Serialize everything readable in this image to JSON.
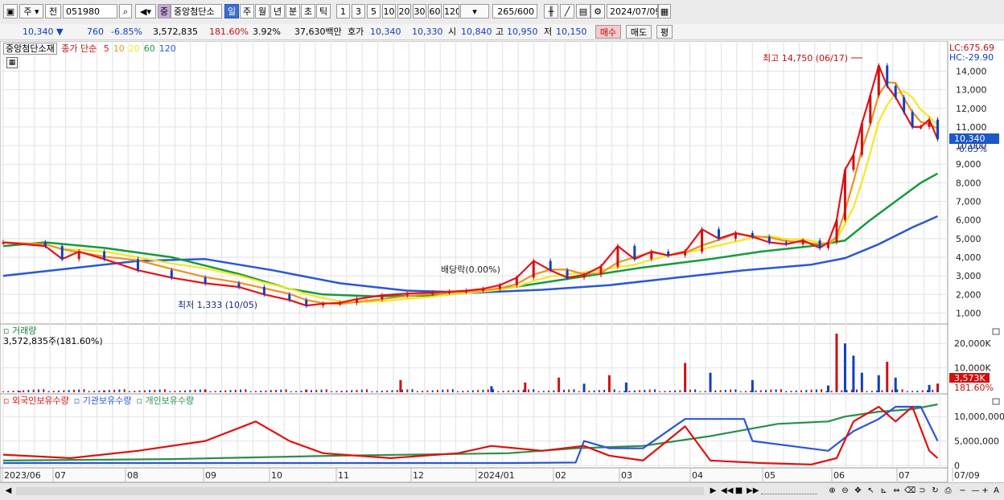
{
  "toolbar": {
    "market": "주",
    "prefix": "전",
    "code": "051980",
    "search_icon": "magnifier-icon",
    "stock_badge": "중",
    "stock_name": "중앙첨단소",
    "periods": [
      "일",
      "주",
      "월",
      "년",
      "분",
      "초",
      "틱"
    ],
    "active_period": "일",
    "intervals": [
      "1",
      "3",
      "5",
      "10",
      "20",
      "30",
      "60",
      "120"
    ],
    "count": "265",
    "count_total": "/600",
    "date": "2024/07/09"
  },
  "quote": {
    "price": "10,340",
    "change": "760",
    "change_pct": "-6.85%",
    "volume": "3,572,835",
    "vol_ratio": "181.60%",
    "turnover": "3.92%",
    "amount": "37,630백만",
    "ask_label": "호가",
    "ask": "10,340",
    "bid": "10,330",
    "open_label": "시",
    "open": "10,840",
    "high_label": "고",
    "high": "10,950",
    "low_label": "저",
    "low": "10,150",
    "buy": "매수",
    "sell": "매도",
    "eval": "평"
  },
  "legend": {
    "name": "중앙첨단소재",
    "type": "종가 단순",
    "ma": [
      {
        "label": "5",
        "color": "#e8101a"
      },
      {
        "label": "10",
        "color": "#f09020"
      },
      {
        "label": "20",
        "color": "#f5e81e"
      },
      {
        "label": "60",
        "color": "#169a3c"
      },
      {
        "label": "120",
        "color": "#2a57d6"
      }
    ]
  },
  "annotations": {
    "high": "최고 14,750 (06/17)",
    "low": "최저 1,333 (10/05)",
    "dividend": "배당락(0.00%)",
    "lc": "LC:675.69",
    "hc": "HC:-29.90",
    "last": "10,340",
    "last_pct": "-6.85%"
  },
  "volume_panel": {
    "title": "거래량",
    "value": "3,572,835주(181.60%)",
    "axis": [
      "20,000K",
      "10,000K"
    ],
    "last": "3,573K",
    "last_pct": "181.60%"
  },
  "holding_panel": {
    "series": [
      {
        "name": "외국인보유수량",
        "color": "#e01010"
      },
      {
        "name": "기관보유수량",
        "color": "#2a57d6"
      },
      {
        "name": "개인보유수량",
        "color": "#2a8f4a"
      }
    ],
    "axis": [
      "10,000,000",
      "5,000,000",
      "0"
    ]
  },
  "chart_data": {
    "type": "line",
    "price_axis": [
      "14,000",
      "13,000",
      "12,000",
      "11,000",
      "10,000",
      "9,000",
      "8,000",
      "7,000",
      "6,000",
      "5,000",
      "4,000",
      "3,000",
      "2,000",
      "1,000"
    ],
    "price_range": [
      500,
      15100
    ],
    "x_labels": [
      "2023/06",
      "07",
      "08",
      "09",
      "10",
      "11",
      "12",
      "2024/01",
      "02",
      "03",
      "04",
      "05",
      "06",
      "07",
      "07/09"
    ],
    "close": [
      [
        0,
        4800
      ],
      [
        25,
        4600
      ],
      [
        35,
        3900
      ],
      [
        45,
        4300
      ],
      [
        60,
        3900
      ],
      [
        80,
        3300
      ],
      [
        100,
        2900
      ],
      [
        120,
        2600
      ],
      [
        140,
        2400
      ],
      [
        155,
        2000
      ],
      [
        170,
        1700
      ],
      [
        180,
        1400
      ],
      [
        190,
        1500
      ],
      [
        200,
        1550
      ],
      [
        210,
        1750
      ],
      [
        225,
        1950
      ],
      [
        240,
        2050
      ],
      [
        255,
        2100
      ],
      [
        265,
        2150
      ],
      [
        275,
        2200
      ],
      [
        285,
        2300
      ],
      [
        295,
        2500
      ],
      [
        305,
        2900
      ],
      [
        315,
        3800
      ],
      [
        325,
        3300
      ],
      [
        335,
        2900
      ],
      [
        345,
        3050
      ],
      [
        355,
        3500
      ],
      [
        365,
        4600
      ],
      [
        375,
        3900
      ],
      [
        385,
        4300
      ],
      [
        395,
        4100
      ],
      [
        405,
        4300
      ],
      [
        415,
        5500
      ],
      [
        425,
        5000
      ],
      [
        435,
        5300
      ],
      [
        445,
        5100
      ],
      [
        455,
        4800
      ],
      [
        465,
        4700
      ],
      [
        475,
        4900
      ],
      [
        485,
        4500
      ],
      [
        490,
        4800
      ],
      [
        495,
        6000
      ],
      [
        500,
        8700
      ],
      [
        505,
        9500
      ],
      [
        510,
        11200
      ],
      [
        515,
        12700
      ],
      [
        520,
        14300
      ],
      [
        525,
        13200
      ],
      [
        530,
        12600
      ],
      [
        535,
        11800
      ],
      [
        540,
        11000
      ],
      [
        545,
        11000
      ],
      [
        550,
        11400
      ],
      [
        555,
        10340
      ]
    ],
    "ma60": [
      [
        0,
        4600
      ],
      [
        25,
        4800
      ],
      [
        60,
        4500
      ],
      [
        100,
        4000
      ],
      [
        140,
        3100
      ],
      [
        170,
        2300
      ],
      [
        190,
        2000
      ],
      [
        220,
        1900
      ],
      [
        260,
        1950
      ],
      [
        300,
        2350
      ],
      [
        340,
        2900
      ],
      [
        380,
        3450
      ],
      [
        420,
        3900
      ],
      [
        450,
        4300
      ],
      [
        480,
        4600
      ],
      [
        500,
        4900
      ],
      [
        515,
        6000
      ],
      [
        530,
        7000
      ],
      [
        545,
        8000
      ],
      [
        555,
        8500
      ]
    ],
    "ma120": [
      [
        0,
        3000
      ],
      [
        40,
        3400
      ],
      [
        80,
        3800
      ],
      [
        120,
        3900
      ],
      [
        160,
        3300
      ],
      [
        200,
        2600
      ],
      [
        240,
        2200
      ],
      [
        280,
        2100
      ],
      [
        320,
        2250
      ],
      [
        360,
        2500
      ],
      [
        400,
        2900
      ],
      [
        440,
        3300
      ],
      [
        480,
        3600
      ],
      [
        500,
        3950
      ],
      [
        520,
        4700
      ],
      [
        540,
        5600
      ],
      [
        555,
        6200
      ]
    ],
    "volume_series": [
      [
        10,
        500
      ],
      [
        60,
        700
      ],
      [
        120,
        900
      ],
      [
        180,
        1100
      ],
      [
        236,
        5000
      ],
      [
        290,
        2500
      ],
      [
        310,
        4000
      ],
      [
        330,
        6000
      ],
      [
        345,
        3500
      ],
      [
        360,
        7000
      ],
      [
        370,
        4000
      ],
      [
        405,
        12000
      ],
      [
        420,
        8000
      ],
      [
        445,
        5000
      ],
      [
        490,
        2800
      ],
      [
        495,
        24000
      ],
      [
        500,
        20000
      ],
      [
        505,
        15000
      ],
      [
        510,
        8000
      ],
      [
        520,
        7000
      ],
      [
        525,
        12500
      ],
      [
        530,
        6000
      ],
      [
        550,
        3000
      ],
      [
        555,
        3573
      ]
    ],
    "foreign_holding": [
      [
        0,
        2200000
      ],
      [
        40,
        1500000
      ],
      [
        80,
        3000000
      ],
      [
        120,
        5000000
      ],
      [
        150,
        9000000
      ],
      [
        170,
        5000000
      ],
      [
        190,
        2500000
      ],
      [
        230,
        1500000
      ],
      [
        270,
        2500000
      ],
      [
        290,
        4000000
      ],
      [
        320,
        3000000
      ],
      [
        345,
        4000000
      ],
      [
        360,
        2000000
      ],
      [
        380,
        1000000
      ],
      [
        405,
        8000000
      ],
      [
        420,
        1000000
      ],
      [
        450,
        500000
      ],
      [
        480,
        200000
      ],
      [
        495,
        1500000
      ],
      [
        505,
        9000000
      ],
      [
        520,
        12000000
      ],
      [
        530,
        9000000
      ],
      [
        540,
        12000000
      ],
      [
        550,
        3000000
      ],
      [
        555,
        1500000
      ]
    ],
    "institution_holding": [
      [
        0,
        500000
      ],
      [
        100,
        500000
      ],
      [
        200,
        500000
      ],
      [
        300,
        500000
      ],
      [
        340,
        600000
      ],
      [
        345,
        5000000
      ],
      [
        360,
        3500000
      ],
      [
        380,
        3500000
      ],
      [
        405,
        9500000
      ],
      [
        440,
        9500000
      ],
      [
        445,
        5000000
      ],
      [
        490,
        3000000
      ],
      [
        505,
        7000000
      ],
      [
        520,
        9500000
      ],
      [
        530,
        12000000
      ],
      [
        545,
        12000000
      ],
      [
        555,
        5000000
      ]
    ],
    "individual_holding": [
      [
        0,
        1000000
      ],
      [
        100,
        1300000
      ],
      [
        200,
        2000000
      ],
      [
        300,
        2500000
      ],
      [
        340,
        3500000
      ],
      [
        380,
        4000000
      ],
      [
        420,
        6000000
      ],
      [
        460,
        8500000
      ],
      [
        490,
        9000000
      ],
      [
        500,
        10000000
      ],
      [
        520,
        11000000
      ],
      [
        540,
        11500000
      ],
      [
        555,
        12500000
      ]
    ],
    "holding_range": [
      0,
      12500000
    ],
    "x_range": [
      0,
      560
    ]
  }
}
